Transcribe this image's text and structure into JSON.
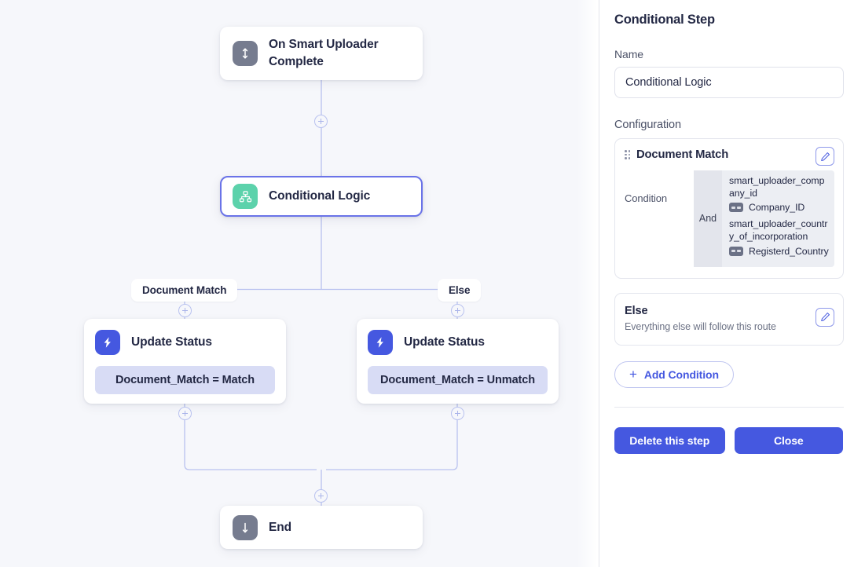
{
  "canvas": {
    "nodes": [
      {
        "id": "trigger",
        "title": "On Smart Uploader Complete",
        "icon": "arrow-up-down-icon",
        "icon_color": "#767c8f"
      },
      {
        "id": "conditional",
        "title": "Conditional Logic",
        "icon": "sitemap-icon",
        "icon_color": "#5cd2ab",
        "selected": true
      },
      {
        "id": "update-match",
        "title": "Update Status",
        "icon": "lightning-bolt-icon",
        "icon_color": "#4558e0",
        "chip": "Document_Match = Match"
      },
      {
        "id": "update-unmatch",
        "title": "Update Status",
        "icon": "lightning-bolt-icon",
        "icon_color": "#4558e0",
        "chip": "Document_Match = Unmatch"
      },
      {
        "id": "end",
        "title": "End",
        "icon": "arrow-down-icon",
        "icon_color": "#767c8f"
      }
    ],
    "branch_labels": {
      "left": "Document Match",
      "right": "Else"
    },
    "edge_color": "#b9c2ef"
  },
  "panel": {
    "title": "Conditional Step",
    "name_label": "Name",
    "name_value": "Conditional Logic",
    "name_placeholder": "Name",
    "configuration_label": "Configuration",
    "condition_card": {
      "title": "Document Match",
      "body_label": "Condition",
      "operator": "And",
      "rules": [
        {
          "field": "smart_uploader_company_id",
          "operator_icon": "equals-icon",
          "value": "Company_ID"
        },
        {
          "field": "smart_uploader_country_of_incorporation",
          "operator_icon": "equals-icon",
          "value": "Registerd_Country"
        }
      ],
      "edit_label": "edit-icon"
    },
    "else_card": {
      "title": "Else",
      "subtitle": "Everything else will follow this route",
      "edit_label": "edit-icon"
    },
    "add_condition_label": "Add Condition",
    "add_condition_glyph": "+",
    "delete_label": "Delete this step",
    "close_label": "Close",
    "accent_color": "#4558e0"
  }
}
